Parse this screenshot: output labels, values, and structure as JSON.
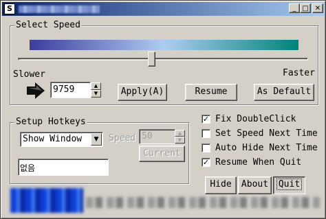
{
  "titlebar": {
    "icon_glyph": "S"
  },
  "window_buttons": {
    "minimize": "_",
    "maximize": "□",
    "close": "✕"
  },
  "select_speed": {
    "legend": "Select Speed",
    "slider_level": 0.46,
    "gradient_colors": [
      "#3c3c9e",
      "#aeccf0",
      "#00837a"
    ],
    "slower_label": "Slower",
    "faster_label": "Faster",
    "speed_value": "9759",
    "apply_label": "Apply(A)",
    "resume_label": "Resume",
    "default_label": "As Default"
  },
  "hotkeys": {
    "legend": "Setup Hotkeys",
    "action_select": "Show Window",
    "speed_label": "Speed",
    "speed_value": "50",
    "current_label": "Current",
    "hotkey_value": "없음"
  },
  "options": {
    "fix_doubleclick": "Fix DoubleClick",
    "set_speed_next": "Set Speed Next Time",
    "auto_hide_next": "Auto Hide Next Time",
    "resume_when_quit": "Resume When Quit",
    "checked": [
      true,
      false,
      false,
      true
    ]
  },
  "footer": {
    "hide_label": "Hide",
    "about_label": "About",
    "quit_label": "Quit"
  }
}
